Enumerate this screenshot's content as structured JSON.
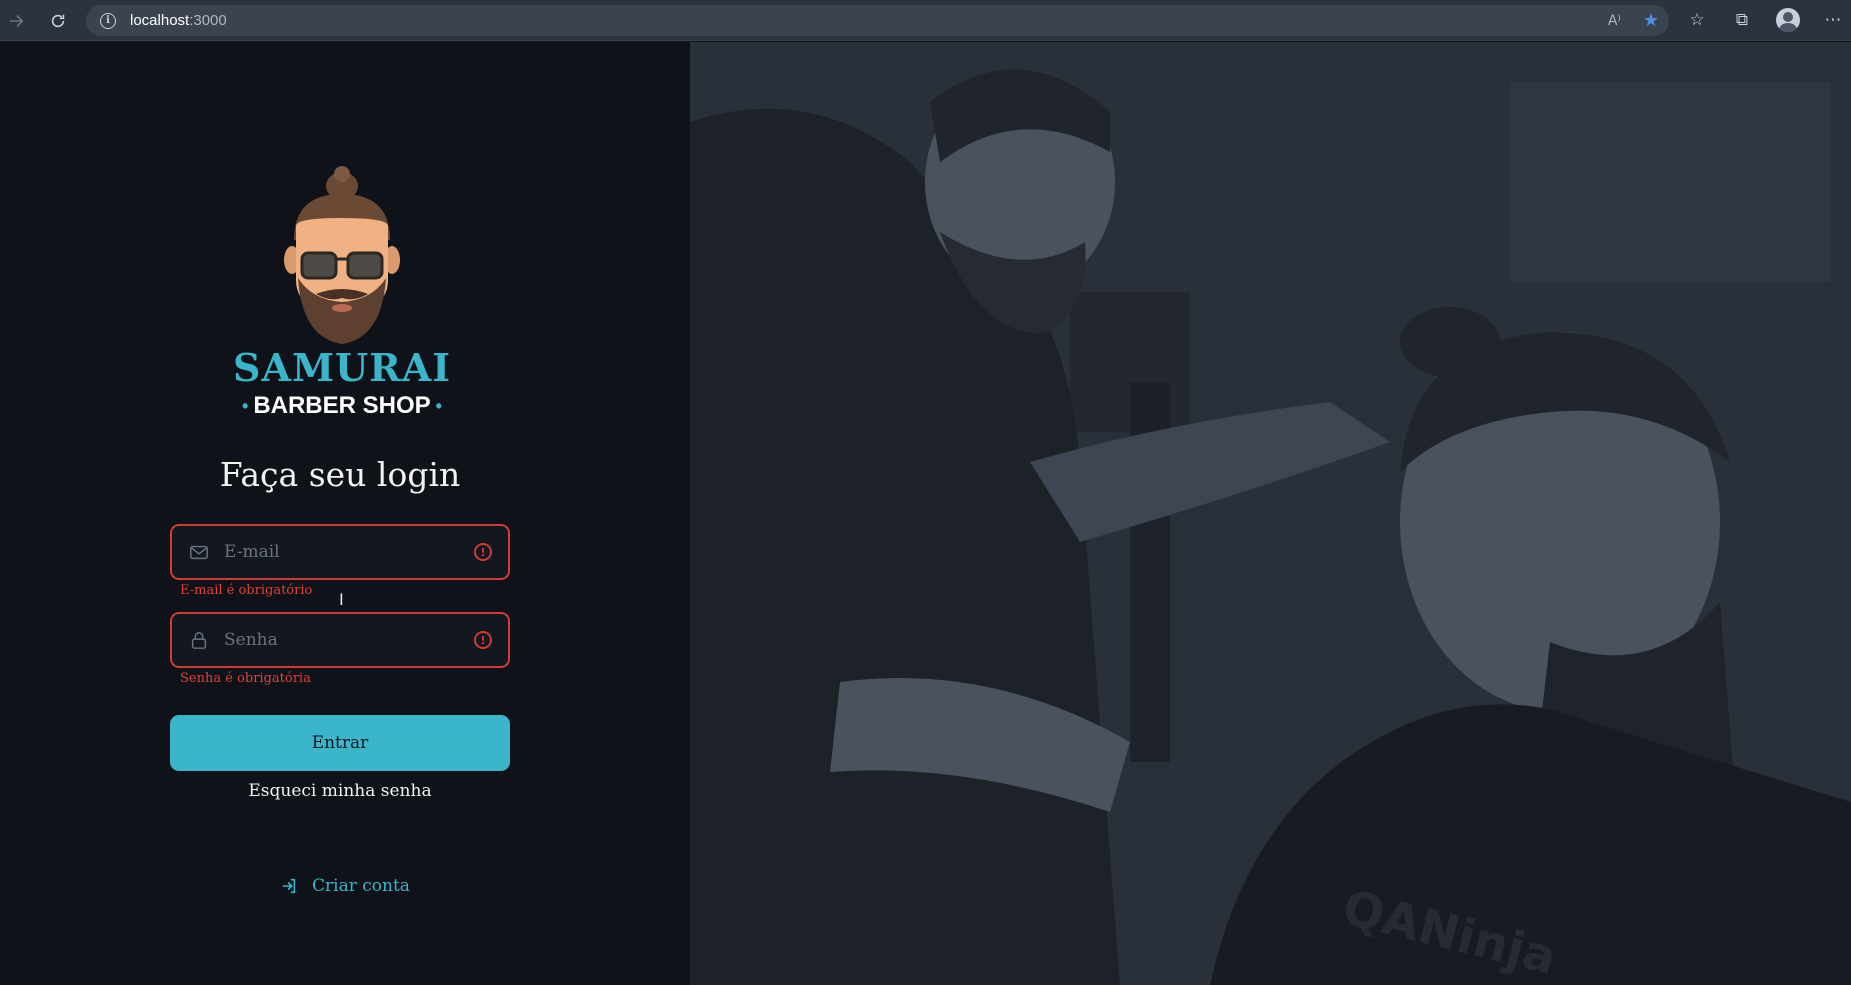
{
  "browser": {
    "url_host": "localhost",
    "url_port": ":3000"
  },
  "logo": {
    "title": "SAMURAI",
    "subtitle": "BARBER SHOP"
  },
  "login": {
    "heading": "Faça seu login",
    "email_placeholder": "E-mail",
    "email_error": "E-mail é obrigatório",
    "password_placeholder": "Senha",
    "password_error": "Senha é obrigatória",
    "submit_label": "Entrar",
    "forgot_label": "Esqueci minha senha",
    "create_label": "Criar conta"
  },
  "photo": {
    "watermark": "QANinja"
  },
  "colors": {
    "accent": "#3ab5c9",
    "error": "#d13a36",
    "background": "#0f1218"
  }
}
